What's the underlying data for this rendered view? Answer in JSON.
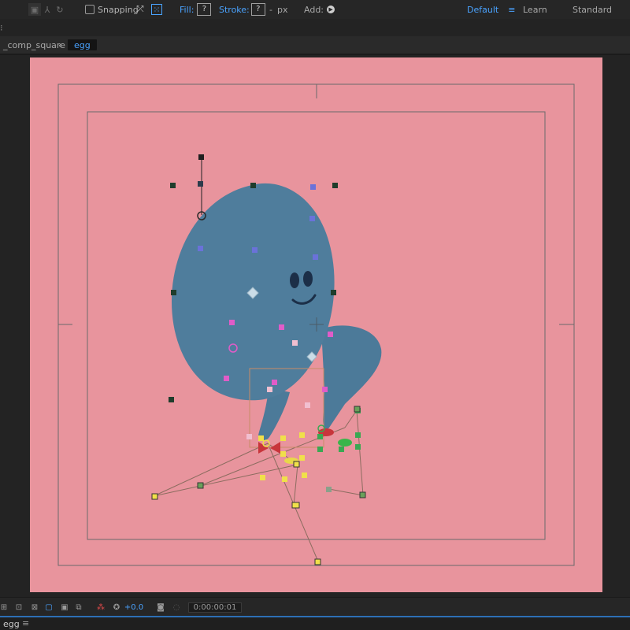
{
  "toolbar": {
    "snapping_label": "Snapping",
    "fill_label": "Fill:",
    "fill_value": "?",
    "stroke_label": "Stroke:",
    "stroke_value": "?",
    "stroke_width_value": "-",
    "stroke_unit": "px",
    "add_label": "Add:",
    "workspaces": [
      "Default",
      "Learn",
      "Standard"
    ],
    "active_workspace": "Default"
  },
  "breadcrumb": {
    "parent": "_comp_square",
    "current": "egg"
  },
  "viewer_controls": {
    "exposure_value": "+0.0",
    "timecode": "0:00:00:01"
  },
  "bottom_panel": {
    "tab_label": "egg"
  },
  "colors": {
    "comp_background": "#e8949d",
    "egg_body": "#4f7d9c",
    "accent_blue": "#4aa3ff",
    "timeline_line": "#2d6fb5"
  }
}
